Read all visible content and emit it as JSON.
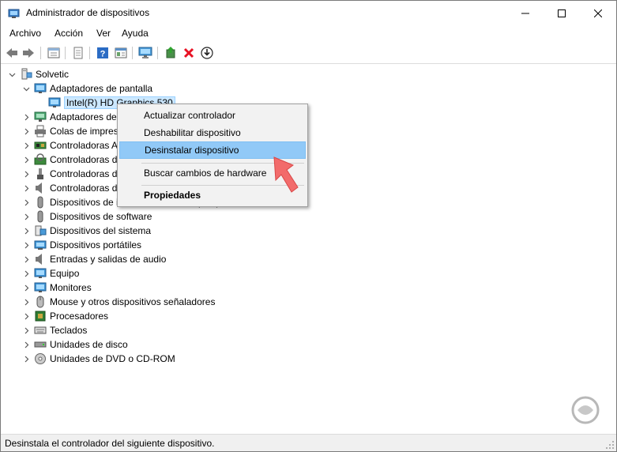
{
  "window": {
    "title": "Administrador de dispositivos",
    "buttons": {
      "minimize": "—",
      "maximize": "☐",
      "close": "✕"
    }
  },
  "menu": [
    "Archivo",
    "Acción",
    "Ver",
    "Ayuda"
  ],
  "toolbar": {
    "icons": [
      "back-icon",
      "forward-icon",
      "properties-icon",
      "show-hide-icon",
      "help-icon",
      "action-icon",
      "monitor-icon",
      "update-driver-icon",
      "uninstall-icon",
      "download-icon"
    ],
    "uninstall_color": "#e81123"
  },
  "tree": {
    "root": "Solvetic",
    "display_adapters": "Adaptadores de pantalla",
    "selected_device": "Intel(R) HD Graphics 530",
    "categories": [
      "Adaptadores de red",
      "Colas de impresión",
      "Controladoras ATA/ATAPI IDE",
      "Controladoras de almacenamiento",
      "Controladoras de bus serie universal",
      "Controladoras de sonido y vídeo y dispositivos de juego",
      "Dispositivos de interfaz de usuario (HID)",
      "Dispositivos de software",
      "Dispositivos del sistema",
      "Dispositivos portátiles",
      "Entradas y salidas de audio",
      "Equipo",
      "Monitores",
      "Mouse y otros dispositivos señaladores",
      "Procesadores",
      "Teclados",
      "Unidades de disco",
      "Unidades de DVD o CD-ROM"
    ]
  },
  "context_menu": {
    "items": [
      "Actualizar controlador",
      "Deshabilitar dispositivo",
      "Desinstalar dispositivo",
      "Buscar cambios de hardware",
      "Propiedades"
    ],
    "highlighted": "Desinstalar dispositivo",
    "highlight_color": "#91c9f7"
  },
  "status": {
    "text": "Desinstala el controlador del siguiente dispositivo."
  },
  "colors": {
    "selection": "#cce8ff",
    "arrow": "#f26b6b"
  }
}
